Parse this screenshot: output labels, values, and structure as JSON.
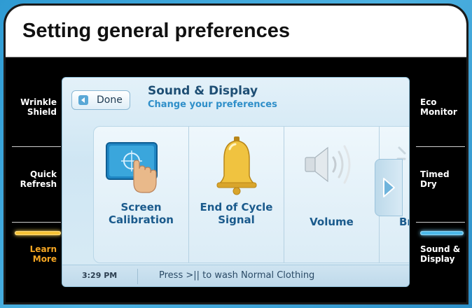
{
  "heading": "Setting general preferences",
  "left_controls": [
    {
      "label": "Wrinkle\nShield"
    },
    {
      "label": "Quick\nRefresh"
    },
    {
      "label": "Learn\nMore"
    }
  ],
  "right_controls": [
    {
      "label": "Eco\nMonitor"
    },
    {
      "label": "Timed\nDry"
    },
    {
      "label": "Sound &\nDisplay"
    }
  ],
  "screen": {
    "done_label": "Done",
    "title": "Sound & Display",
    "subtitle": "Change your preferences",
    "tiles": [
      {
        "label": "Screen\nCalibration",
        "icon": "touch-screen-icon"
      },
      {
        "label": "End of Cycle\nSignal",
        "icon": "bell-icon"
      },
      {
        "label": "Volume",
        "icon": "speaker-icon"
      },
      {
        "label": "Br",
        "icon": "brightness-icon"
      }
    ],
    "status": {
      "time": "3:29 PM",
      "message": "Press >|| to wash Normal Clothing"
    }
  },
  "colors": {
    "active_amber": "#f7c230",
    "active_blue": "#47b8ea",
    "accent_text": "#1a5a8c"
  }
}
